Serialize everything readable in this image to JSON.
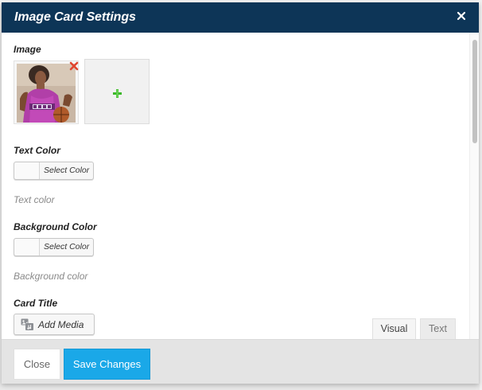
{
  "modal": {
    "title": "Image Card Settings",
    "close_icon": "close-icon"
  },
  "image_section": {
    "label": "Image",
    "remove_icon": "remove-icon",
    "add_icon": "plus-icon"
  },
  "text_color": {
    "label": "Text Color",
    "button_label": "Select Color",
    "hint": "Text color"
  },
  "background_color": {
    "label": "Background Color",
    "button_label": "Select Color",
    "hint": "Background color"
  },
  "card_title": {
    "label": "Card Title",
    "add_media_label": "Add Media",
    "media_icon": "media-icon",
    "tabs": [
      {
        "label": "Visual"
      },
      {
        "label": "Text"
      }
    ]
  },
  "footer": {
    "close_label": "Close",
    "save_label": "Save Changes"
  },
  "colors": {
    "header_bg": "#0d3557",
    "save_button": "#1aa8e8",
    "remove_icon": "#e0452f",
    "add_icon": "#3cb82b"
  }
}
